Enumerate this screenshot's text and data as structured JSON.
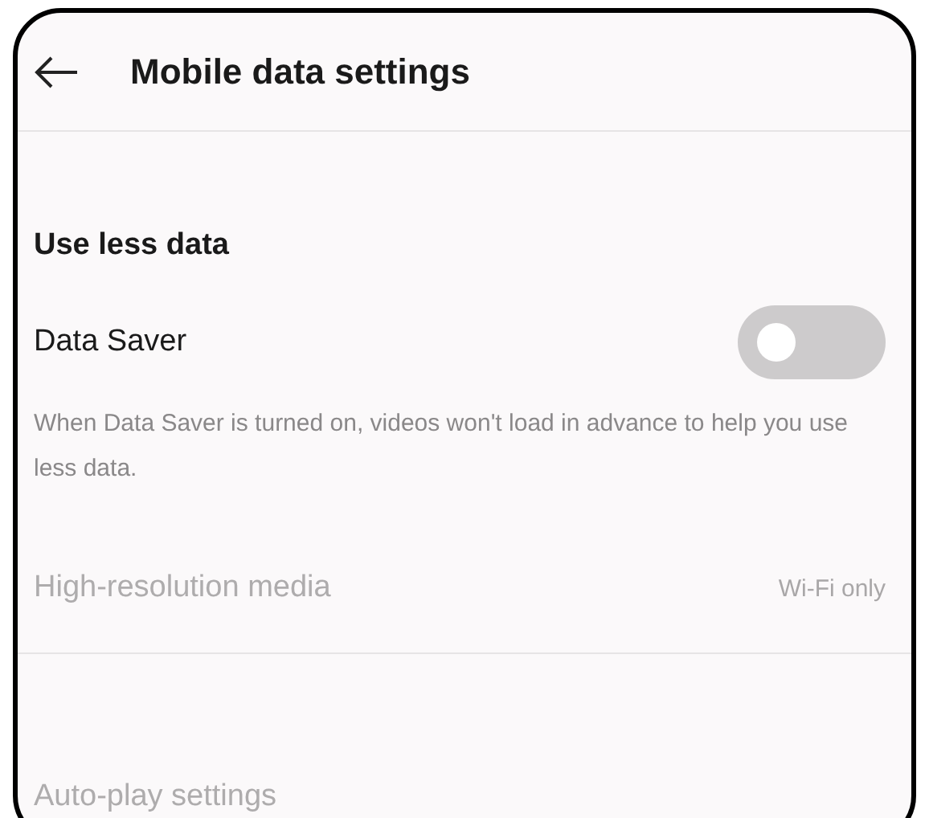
{
  "header": {
    "title": "Mobile data settings"
  },
  "section": {
    "title": "Use less data"
  },
  "data_saver": {
    "label": "Data Saver",
    "on": false,
    "description": "When Data Saver is turned on, videos won't load in advance to help you use less data."
  },
  "items": [
    {
      "label": "High-resolution media",
      "value": "Wi-Fi only",
      "disabled": true
    },
    {
      "label": "Auto-play settings",
      "disabled": true
    }
  ]
}
